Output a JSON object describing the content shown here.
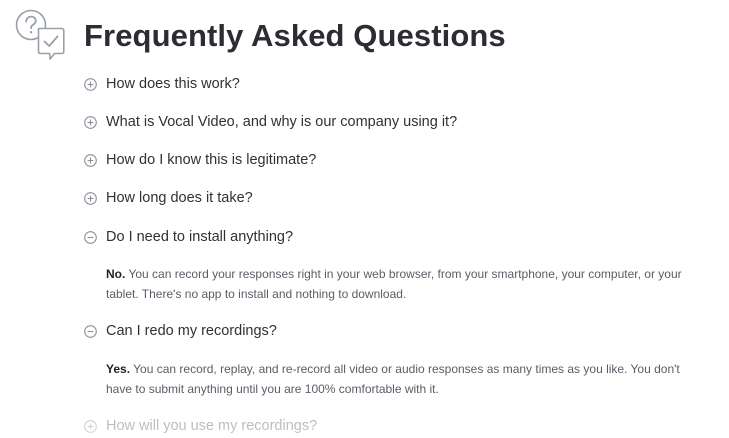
{
  "page": {
    "title": "Frequently Asked Questions",
    "header_icon": "question-checkmark-chat-icon"
  },
  "faq": {
    "items": [
      {
        "question": "How does this work?",
        "expanded": false,
        "icon": "plus-circle-icon"
      },
      {
        "question": "What is Vocal Video, and why is our company using it?",
        "expanded": false,
        "icon": "plus-circle-icon"
      },
      {
        "question": "How do I know this is legitimate?",
        "expanded": false,
        "icon": "plus-circle-icon"
      },
      {
        "question": "How long does it take?",
        "expanded": false,
        "icon": "plus-circle-icon"
      },
      {
        "question": "Do I need to install anything?",
        "expanded": true,
        "icon": "minus-circle-icon",
        "answer_lead": "No.",
        "answer_text": "You can record your responses right in your web browser, from your smartphone, your computer, or your tablet. There's no app to install and nothing to download."
      },
      {
        "question": "Can I redo my recordings?",
        "expanded": true,
        "icon": "minus-circle-icon",
        "answer_lead": "Yes.",
        "answer_text": "You can record, replay, and re-record all video or audio responses as many times as you like. You don't have to submit anything until you are 100% comfortable with it."
      },
      {
        "question": "How will you use my recordings?",
        "expanded": false,
        "icon": "plus-circle-icon"
      }
    ]
  },
  "colors": {
    "text": "#2b2d33",
    "answer_text": "#5a5d66",
    "icon_stroke": "#8c9099",
    "header_icon_stroke": "#9aa0aa",
    "faded_text": "#a7aab1"
  }
}
